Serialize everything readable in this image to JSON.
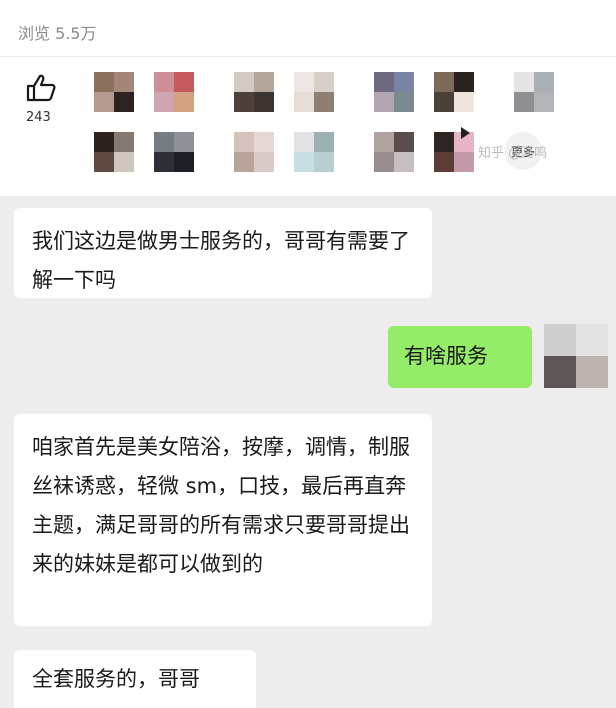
{
  "header": {
    "views_label": "浏览 5.5万"
  },
  "like": {
    "icon": "thumbs-up-icon",
    "count": "243"
  },
  "avatars": [
    {
      "colors": [
        "#8d7060",
        "#a5867a",
        "#b49a8f",
        "#2b2421"
      ]
    },
    {
      "colors": [
        "#cf8e97",
        "#c45a60",
        "#cfa5b1",
        "#d4a27f"
      ]
    },
    {
      "colors": [
        "#d4cac3",
        "#b5a79c",
        "#4e3f38",
        "#3c3430"
      ]
    },
    {
      "colors": [
        "#efe6e6",
        "#d9cfc9",
        "#e6ddd7",
        "#8e7f73"
      ]
    },
    {
      "colors": [
        "#6f6a80",
        "#7983a6",
        "#b1a6b2",
        "#7b8990"
      ]
    },
    {
      "colors": [
        "#7d6a58",
        "#2a2420",
        "#4a4138",
        "#efe5da"
      ]
    },
    {
      "colors": [
        "#e5e5e5",
        "#aab0b6",
        "#8d8f92",
        "#b2b5b8"
      ]
    },
    {
      "colors": [
        "#2d221e",
        "#86796f",
        "#5f4b43",
        "#cfc6bd"
      ]
    },
    {
      "colors": [
        "#747c84",
        "#8e9296",
        "#2c3036",
        "#1b1e22"
      ]
    },
    {
      "colors": [
        "#d7c1bb",
        "#e6d8d5",
        "#b9a39b",
        "#d9cbc7"
      ]
    },
    {
      "colors": [
        "#e2e3e5",
        "#9cb1b1",
        "#c7dfe0",
        "#b8cfd0"
      ]
    },
    {
      "colors": [
        "#b0a3a1",
        "#5a4d4c",
        "#978d8d",
        "#c6bfbf"
      ]
    },
    {
      "colors": [
        "#2f2522",
        "#e7b5c6",
        "#5c3c37",
        "#c49aaa"
      ]
    }
  ],
  "more_button": {
    "label": "更多"
  },
  "watermark": {
    "text": "知乎 @马鸣"
  },
  "chat": {
    "messages": [
      {
        "side": "left",
        "text": "我们这边是做男士服务的，哥哥有需要了解一下吗"
      },
      {
        "side": "right",
        "text": "有啥服务"
      },
      {
        "side": "left",
        "text": "咱家首先是美女陪浴，按摩，调情，制服丝袜诱惑，轻微 sm，口技，最后再直奔主题，满足哥哥的所有需求只要哥哥提出来的妹妹是都可以做到的"
      },
      {
        "side": "left",
        "text": "全套服务的，哥哥"
      }
    ],
    "self_avatar": {
      "colors": [
        "#cfcfcf",
        "#e3e3e3",
        "#5d5656",
        "#bcb3b0"
      ]
    }
  }
}
